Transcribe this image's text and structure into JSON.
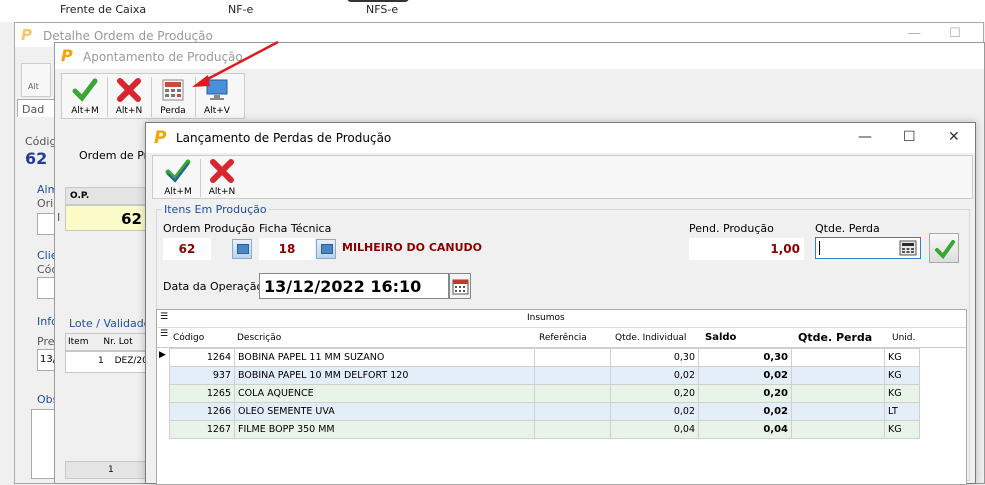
{
  "top_menu": {
    "item1": "Frente de Caixa",
    "item2": "NF-e",
    "item3": "NFS-e"
  },
  "window_detail": {
    "logo": "P",
    "title": "Detalhe Ordem de Produção",
    "minimize": "—",
    "maximize": "☐",
    "toolbar_label": "Alt",
    "tab_label": "Dad",
    "codigo_label": "Códig",
    "codigo_value": "62",
    "alm_label": "Alm",
    "orig_label": "Orig",
    "cli_label": "Clie",
    "cod_label": "Cód",
    "info_label": "Info",
    "prev_label": "Prev",
    "date_value": "13/",
    "obs_label": "Obs"
  },
  "window_apontamento": {
    "logo": "P",
    "title": "Apontamento de Produção",
    "toolbar": [
      {
        "label": "Alt+M",
        "icon": "check-icon"
      },
      {
        "label": "Alt+N",
        "icon": "cancel-icon"
      },
      {
        "label": "Perda",
        "icon": "calculator-icon"
      },
      {
        "label": "Alt+V",
        "icon": "monitor-icon"
      }
    ],
    "ordem_label": "Ordem de Pro",
    "op_header": "O.P.",
    "op_value": "62",
    "row_marker": "I",
    "lote_label": "Lote / Validade A",
    "item_header": "Item",
    "nr_lote_header": "Nr. Lot",
    "item_value": "1",
    "lote_value": "DEZ/20",
    "pager_value": "1"
  },
  "dialog": {
    "logo": "P",
    "title": "Lançamento de Perdas de Produção",
    "minimize": "—",
    "maximize": "☐",
    "close": "✕",
    "toolbar": [
      {
        "label": "Alt+M",
        "icon": "check-icon"
      },
      {
        "label": "Alt+N",
        "icon": "cancel-icon"
      }
    ],
    "group_label": "Itens Em Produção",
    "ordem_label": "Ordem Produção",
    "ordem_value": "62",
    "ficha_label": "Ficha Técnica",
    "ficha_value": "18",
    "produto_nome": "MILHEIRO DO CANUDO",
    "pend_label": "Pend. Produção",
    "pend_value": "1,00",
    "qtde_perda_label": "Qtde. Perda",
    "qtde_perda_value": "",
    "data_label": "Data da Operação:",
    "data_value": "13/12/2022 16:10",
    "insumos_title": "Insumos",
    "columns": [
      "Código",
      "Descrição",
      "Referência",
      "Qtde. Individual",
      "Saldo",
      "Qtde. Perda",
      "Unid."
    ],
    "rows": [
      {
        "codigo": "1264",
        "descricao": "BOBINA PAPEL 11 MM SUZANO",
        "referencia": "",
        "qtde_individual": "0,30",
        "saldo": "0,30",
        "qtde_perda": "",
        "unid": "KG"
      },
      {
        "codigo": "937",
        "descricao": "BOBINA PAPEL 10 MM DELFORT 120",
        "referencia": "",
        "qtde_individual": "0,02",
        "saldo": "0,02",
        "qtde_perda": "",
        "unid": "KG"
      },
      {
        "codigo": "1265",
        "descricao": "COLA AQUENCE",
        "referencia": "",
        "qtde_individual": "0,20",
        "saldo": "0,20",
        "qtde_perda": "",
        "unid": "KG"
      },
      {
        "codigo": "1266",
        "descricao": "OLEO SEMENTE UVA",
        "referencia": "",
        "qtde_individual": "0,02",
        "saldo": "0,02",
        "qtde_perda": "",
        "unid": "LT"
      },
      {
        "codigo": "1267",
        "descricao": "FILME BOPP 350 MM",
        "referencia": "",
        "qtde_individual": "0,04",
        "saldo": "0,04",
        "qtde_perda": "",
        "unid": "KG"
      }
    ]
  },
  "colors": {
    "accent_logo": "#f4a300",
    "label_blue": "#1f4fa0",
    "value_red": "#8b0000",
    "arrow_red": "#e0191e"
  }
}
